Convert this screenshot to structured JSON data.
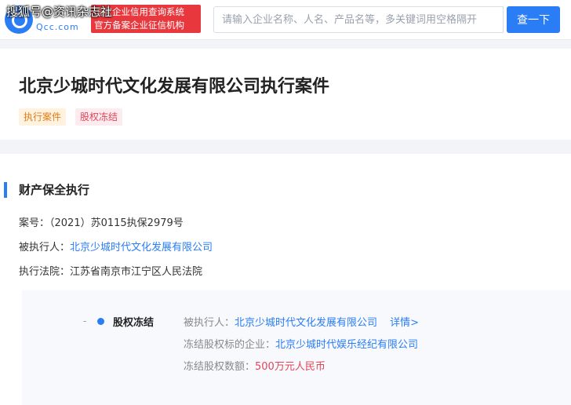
{
  "header": {
    "watermark": "搜狐号@资讯杂志社",
    "logo_domain": "Qcc.com",
    "slogan_line1": "国家企业信用查询系统",
    "slogan_line2": "官方备案企业征信机构",
    "search_placeholder": "请输入企业名称、人名、产品名等，多关键词用空格隔开",
    "search_value": "",
    "search_button": "查一下"
  },
  "title_card": {
    "title": "北京少城时代文化发展有限公司执行案件",
    "tags": [
      "执行案件",
      "股权冻结"
    ]
  },
  "section": {
    "title": "财产保全执行",
    "case_no_label": "案号：",
    "case_no": "（2021）苏0115执保2979号",
    "executed_label": "被执行人：",
    "executed": "北京少城时代文化发展有限公司",
    "court_label": "执行法院：",
    "court": "江苏省南京市江宁区人民法院"
  },
  "event": {
    "dash": "-",
    "type": "股权冻结",
    "executed_label": "被执行人：",
    "executed": "北京少城时代文化发展有限公司",
    "detail_link": "详情>",
    "target_label": "冻结股权标的企业：",
    "target": "北京少城时代娱乐经纪有限公司",
    "amount_label": "冻结股权数额：",
    "amount": "500万元人民币"
  },
  "colors": {
    "accent": "#2b7df5",
    "slogan_bg": "#e8383d",
    "money": "#e0455a"
  }
}
